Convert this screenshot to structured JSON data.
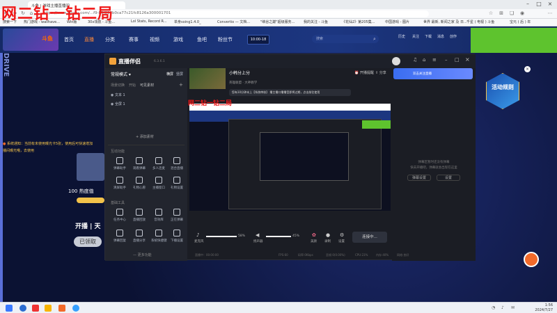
{
  "watermark": "网二钻一钻二局",
  "browser": {
    "tab_title": "斗鱼 | 游戏主播直播间",
    "url": "https://www.douyu.com/...f9-83f898b0ca77c21fc8126a300001701",
    "bookmarks": [
      "搜索一下",
      "热门游戏 - wallhave...",
      "Win版",
      "30x领航 - 斗鱼...",
      "Lol Stats, Record R...",
      "单身soing1.4.0_",
      "Convertio — 文档...",
      "\"峡谷之巅\"超级服务...",
      "我的关注 - 斗鱼",
      "《花仙2》第205集...",
      "中国游戏 - 图片",
      "世界 最新, 新闻之家 及 日...",
      "千星 ( 电视 ) 斗鱼",
      "宝元 ( 后 ) 年"
    ]
  },
  "site": {
    "nav": [
      "首页",
      "直播",
      "分类",
      "赛事",
      "视频",
      "游戏",
      "鱼吧",
      "粉丝节"
    ],
    "search_placeholder": "搜索",
    "user_area": [
      "历史",
      "关注",
      "下载",
      "消息",
      "创作",
      "开播"
    ],
    "promo_time": "10:00-18"
  },
  "left_page": {
    "notice1": "系统通知：当前有未使用曝光卡5张，使用后可快速增加",
    "notice2": "播间曝光哦，去使用",
    "hot": "100 热度值",
    "cta": "开播 | 天",
    "claimed": "已领取"
  },
  "app": {
    "name": "直播伴侣",
    "version": "6.3.6.1",
    "mode": "常规模式",
    "mode_tabs": [
      "横屏",
      "竖屏"
    ],
    "scene_header": [
      "场景切换",
      "开始",
      "可见素材"
    ],
    "sources": [
      "文本 1",
      "全屏 1"
    ],
    "add_source": "+ 添加素材",
    "sections": [
      "互动功能",
      "基础工具"
    ],
    "tools_row1": [
      "弹幕助手",
      "观看弹幕",
      "多人连麦",
      "混合直播"
    ],
    "tools_row2": [
      "清屏助手",
      "礼物心愿",
      "主播窗口",
      "礼物设置"
    ],
    "tools_row3": [
      "任务中心",
      "直播回放",
      "音效库",
      "正在弹幕"
    ],
    "tools_row4": [
      "弹幕回复",
      "直播分享",
      "系统快捷键",
      "下播设置"
    ],
    "more_tools": "— 更多功能",
    "room_title": "小韩分上分",
    "room_meta": "英雄联盟 · 大神教学",
    "tip": "您有10分钟未上【系统审核】 播主播口播播音即将过期，点击前往使用",
    "open_live_btn": "开播提醒",
    "share_btn": "分享",
    "right_empty": "弹幕区暂时还没有弹幕",
    "right_empty2": "快去开播吧，弹幕就会出现在这里",
    "right_btn1": "弹幕设置",
    "right_btn2": "设置",
    "banner": "双击关注直播",
    "mic_label": "麦克风",
    "mic_level": "58%",
    "speaker_label": "扬声器",
    "speaker_level": "45%",
    "bottom_icons": [
      "美颜",
      "录制",
      "设置"
    ],
    "start_btn": "连接中...",
    "status": [
      "直播中：00:00:00",
      "FPS:60",
      "码率:0Kbps",
      "丢帧:0(0.00%)",
      "CPU:23%",
      "内存:40%",
      "网络:良好"
    ],
    "activity_badge": "活动规则",
    "preview_watermark": "网二钻一钻二局"
  },
  "taskbar": {
    "time": "1:56",
    "date": "2024/7/27"
  },
  "colors": {
    "accent": "#5ec32e",
    "brand": "#ff6a00",
    "red": "#f01818",
    "blue": "#3a6df0"
  }
}
